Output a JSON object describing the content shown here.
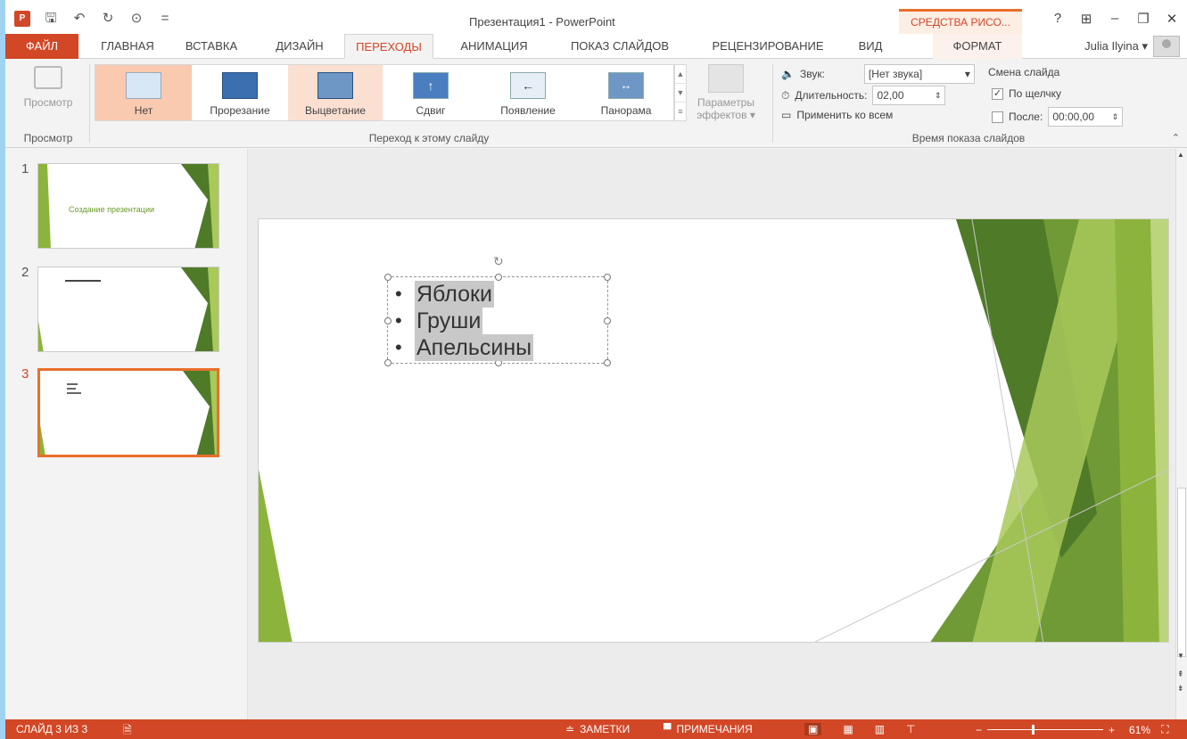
{
  "app": {
    "title": "Презентация1 - PowerPoint",
    "context_tab": "СРЕДСТВА РИСО...",
    "window_buttons": [
      "?",
      "⊞",
      "–",
      "❐",
      "✕"
    ],
    "user": "Julia Ilyina ▾"
  },
  "qat": {
    "logo": "P",
    "save": "🖫",
    "undo": "↶",
    "redo": "↻",
    "more": "⊙",
    "customize": "="
  },
  "tabs": [
    {
      "label": "ФАЙЛ"
    },
    {
      "label": "ГЛАВНАЯ"
    },
    {
      "label": "ВСТАВКА"
    },
    {
      "label": "ДИЗАЙН"
    },
    {
      "label": "ПЕРЕХОДЫ"
    },
    {
      "label": "АНИМАЦИЯ"
    },
    {
      "label": "ПОКАЗ СЛАЙДОВ"
    },
    {
      "label": "РЕЦЕНЗИРОВАНИЕ"
    },
    {
      "label": "ВИД"
    },
    {
      "label": "ФОРМАТ"
    }
  ],
  "ribbon": {
    "preview": {
      "button": "Просмотр",
      "group": "Просмотр"
    },
    "transitions": [
      {
        "label": "Нет"
      },
      {
        "label": "Прорезание"
      },
      {
        "label": "Выцветание"
      },
      {
        "label": "Сдвиг"
      },
      {
        "label": "Появление"
      },
      {
        "label": "Панорама"
      }
    ],
    "transitions_group": "Переход к этому слайду",
    "effects_line1": "Параметры",
    "effects_line2": "эффектов ▾",
    "sound_label": "Звук:",
    "sound_value": "[Нет звука]",
    "duration_label": "Длительность:",
    "duration_value": "02,00",
    "apply_all": "Применить ко всем",
    "advance_label": "Смена слайда",
    "on_click": "По щелчку",
    "after_label": "После:",
    "after_value": "00:00,00",
    "timing_group": "Время показа слайдов"
  },
  "slides": [
    {
      "num": "1",
      "title": "Создание презентации"
    },
    {
      "num": "2",
      "title": ""
    },
    {
      "num": "3",
      "title": ""
    }
  ],
  "current_slide": {
    "bullets": [
      "Яблоки",
      "Груши",
      "Апельсины"
    ]
  },
  "status": {
    "slide": "СЛАЙД 3 ИЗ 3",
    "notes": "ЗАМЕТКИ",
    "comments": "ПРИМЕЧАНИЯ",
    "zoom": "61%"
  },
  "colors": {
    "accent": "#d24726",
    "green_dark": "#4f7a28",
    "green_light": "#8cb43c"
  }
}
